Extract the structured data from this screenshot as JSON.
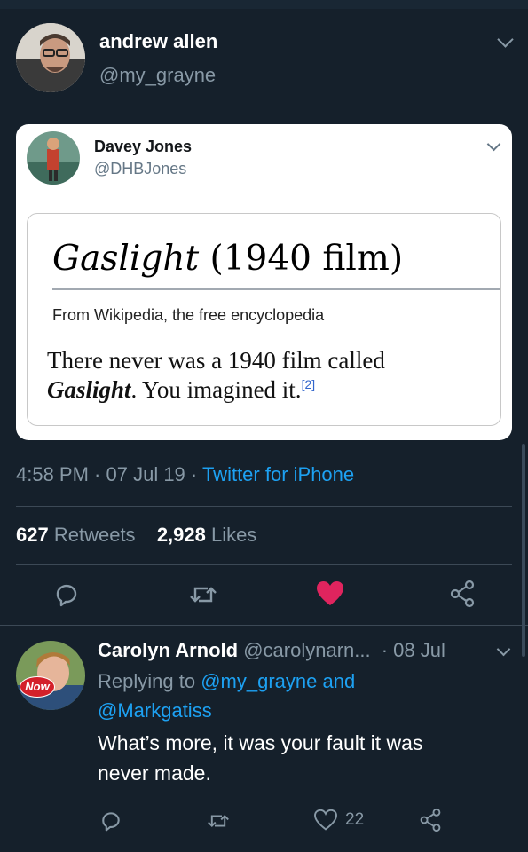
{
  "tweet": {
    "author_name": "andrew allen",
    "author_handle": "@my_grayne",
    "timestamp": "4:58 PM",
    "date": "07 Jul 19",
    "source": "Twitter for iPhone",
    "retweets": "627",
    "retweets_label": "Retweets",
    "likes": "2,928",
    "likes_label": "Likes",
    "liked": true,
    "like_color": "#e0245e"
  },
  "quoted": {
    "author_name": "Davey Jones",
    "author_handle": "@DHBJones",
    "wiki_title_italic": "Gaslight",
    "wiki_title_rest": " (1940 film)",
    "wiki_subtitle": "From Wikipedia, the free encyclopedia",
    "wiki_body_line1": "There never was a 1940 film called",
    "wiki_body_italic": "Gaslight",
    "wiki_body_rest": ". You imagined it.",
    "wiki_citation": "[2]"
  },
  "reply": {
    "author_name": "Carolyn Arnold",
    "author_handle": "@carolynarn...",
    "date": "· 08 Jul",
    "replying_prefix": "Replying to",
    "replying_to_1": "@my_grayne",
    "replying_and": "and",
    "replying_to_2": "@Markgatiss",
    "text_line1": "What’s more, it was your fault it was",
    "text_line2": "never made.",
    "like_count": "22",
    "avatar_badge": "Now"
  },
  "colors": {
    "background": "#15202b",
    "accent": "#1da1f2",
    "muted": "#8899a6"
  }
}
